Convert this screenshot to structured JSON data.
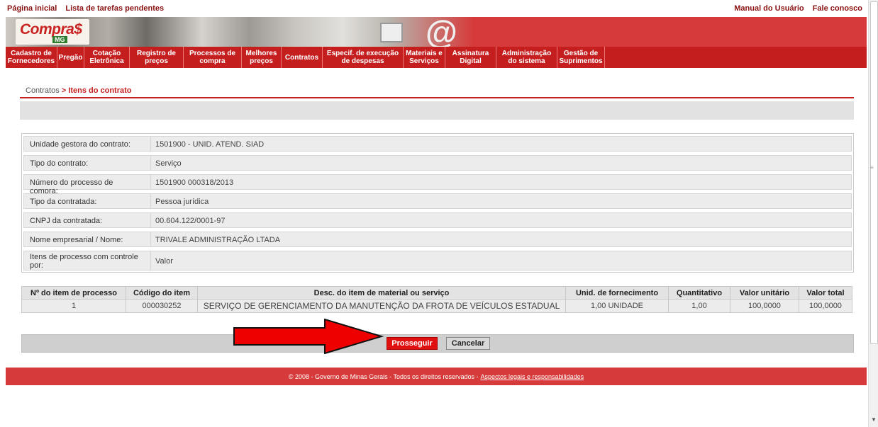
{
  "top_links": {
    "left": [
      "Página inicial",
      "Lista de tarefas pendentes"
    ],
    "right": [
      "Manual do Usuário",
      "Fale conosco"
    ]
  },
  "banner": {
    "logo_text": "Compra$",
    "logo_sub": "MG",
    "accent": "#d63a3a"
  },
  "nav": {
    "items": [
      "Cadastro de\nFornecedores",
      "Pregão",
      "Cotação\nEletrônica",
      "Registro de\npreços",
      "Processos de\ncompra",
      "Melhores\npreços",
      "Contratos",
      "Especif. de execução\nde despesas",
      "Materiais e\nServiços",
      "Assinatura\nDigital",
      "Administração\ndo sistema",
      "Gestão de\nSuprimentos"
    ]
  },
  "breadcrumb": {
    "parent": "Contratos",
    "separator": ">",
    "current": "Itens do contrato"
  },
  "details": [
    {
      "label": "Unidade gestora do contrato:",
      "value": "1501900 - UNID. ATEND. SIAD"
    },
    {
      "label": "Tipo do contrato:",
      "value": "Serviço"
    },
    {
      "label": "Número do processo de compra:",
      "value": "1501900 000318/2013"
    },
    {
      "label": "Tipo da contratada:",
      "value": "Pessoa jurídica"
    },
    {
      "label": "CNPJ da contratada:",
      "value": "00.604.122/0001-97"
    },
    {
      "label": "Nome empresarial / Nome:",
      "value": "TRIVALE ADMINISTRAÇÃO LTADA"
    },
    {
      "label": "Itens de processo com controle por:",
      "value": "Valor"
    }
  ],
  "items_table": {
    "headers": [
      "Nº do item de processo",
      "Código do item",
      "Desc. do item de material ou serviço",
      "Unid. de fornecimento",
      "Quantitativo",
      "Valor unitário",
      "Valor total"
    ],
    "rows": [
      [
        "1",
        "000030252",
        "SERVIÇO DE GERENCIAMENTO DA MANUTENÇÃO DA FROTA DE VEÍCULOS ESTADUAL",
        "1,00 UNIDADE",
        "1,00",
        "100,0000",
        "100,0000"
      ]
    ]
  },
  "actions": {
    "proceed": "Prosseguir",
    "cancel": "Cancelar"
  },
  "footer": {
    "text": "© 2008 - Governo de Minas Gerais - Todos os direitos reservados -",
    "link": "Aspectos legais e responsabilidades"
  },
  "colors": {
    "brand_red": "#c41e1e",
    "arrow_red": "#ee0000",
    "button_red": "#e01010"
  }
}
